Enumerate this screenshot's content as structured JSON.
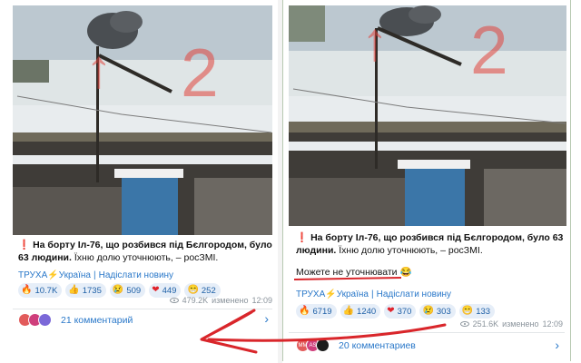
{
  "left_post": {
    "caption_prefix": "❗",
    "caption_bold": "На борту Іл-76, що розбився під Бєлгородом, було 63 людини.",
    "caption_rest": " Їхню долю уточнюють, – росЗМІ.",
    "link_channel": "ТРУХА",
    "link_bolt": "⚡",
    "link_country": "Україна",
    "link_send": "Надіслати новину",
    "reactions": [
      {
        "emoji": "🔥",
        "count": "10.7K"
      },
      {
        "emoji": "👍",
        "count": "1735"
      },
      {
        "emoji": "😢",
        "count": "509"
      },
      {
        "emoji": "❤",
        "count": "449"
      },
      {
        "emoji": "😁",
        "count": "252"
      }
    ],
    "views": "479.2K",
    "edited_label": "изменено",
    "time": "12:09",
    "comments_label": "21 комментарий",
    "avatars": [
      "",
      "",
      ""
    ]
  },
  "right_post": {
    "caption_prefix": "❗",
    "caption_bold": "На борту Іл-76, що розбився під Бєлгородом, було 63 людини.",
    "caption_rest": " Їхню долю уточнюють, – росЗМІ.",
    "extra_line": "Можете не уточнювати 😂",
    "link_channel": "ТРУХА",
    "link_bolt": "⚡",
    "link_country": "Україна",
    "link_send": "Надіслати новину",
    "reactions": [
      {
        "emoji": "🔥",
        "count": "6719"
      },
      {
        "emoji": "👍",
        "count": "1240"
      },
      {
        "emoji": "❤",
        "count": "370"
      },
      {
        "emoji": "😢",
        "count": "303"
      },
      {
        "emoji": "😁",
        "count": "133"
      }
    ],
    "views": "251.6K",
    "edited_label": "изменено",
    "time": "12:09",
    "comments_label": "20 комментариев",
    "avatars": [
      "MM",
      "AS",
      ""
    ]
  },
  "colors": {
    "link_blue": "#2a78c9",
    "annotation_red": "#d9262b",
    "reaction_bg": "#e6eef8"
  },
  "icons": [
    "eye-icon",
    "chevron-right-icon",
    "red-arrow-annotation"
  ]
}
